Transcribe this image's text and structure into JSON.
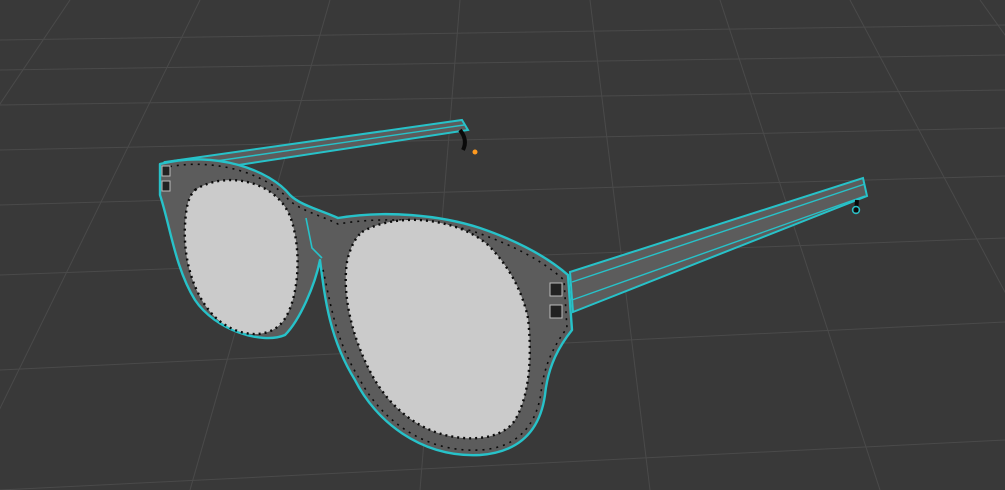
{
  "viewport": {
    "mode": "edit-mode-wireframe",
    "object": "glasses",
    "colors": {
      "background": "#393939",
      "grid": "#4a4a4a",
      "face": "#5c5c5c",
      "lens": "#cbcbcb",
      "edge_selected": "#27c2c9",
      "vertex": "#0a0a0a",
      "origin": "#ff9a1f"
    }
  }
}
